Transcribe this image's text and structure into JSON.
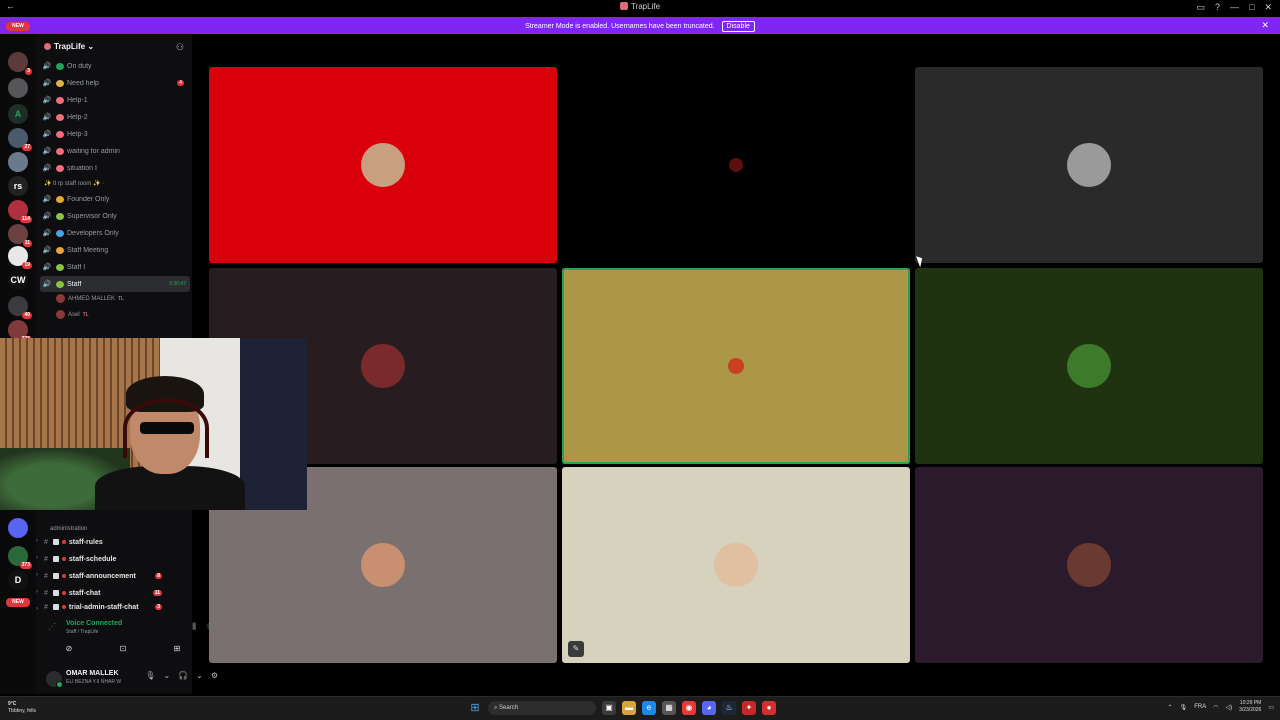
{
  "window": {
    "title": "TrapLife"
  },
  "banner": {
    "text": "Streamer Mode is enabled. Usernames have been truncated.",
    "disable_label": "Disable",
    "close_icon": "✕",
    "color": "#7f26f0"
  },
  "rail": {
    "new_top": "NEW",
    "new_bottom": "NEW",
    "servers": [
      {
        "label": "",
        "badge": "3"
      },
      {
        "label": "",
        "badge": ""
      },
      {
        "label": "A",
        "badge": ""
      },
      {
        "label": "",
        "badge": "27"
      },
      {
        "label": "",
        "badge": ""
      },
      {
        "label": "rs",
        "badge": ""
      },
      {
        "label": "",
        "badge": "114"
      },
      {
        "label": "",
        "badge": "11"
      },
      {
        "label": "",
        "badge": "19"
      },
      {
        "label": "CW",
        "badge": ""
      },
      {
        "label": "",
        "badge": "40"
      },
      {
        "label": "",
        "badge": "376"
      },
      {
        "label": "",
        "badge": ""
      },
      {
        "label": "",
        "badge": ""
      },
      {
        "label": "",
        "badge": "373"
      },
      {
        "label": "D",
        "badge": ""
      }
    ]
  },
  "server": {
    "name": "TrapLife",
    "chevron": "⌄"
  },
  "voice_channels": [
    {
      "label": "On duty",
      "color": "#23a559",
      "count": ""
    },
    {
      "label": "Need help",
      "color": "#dbb14a",
      "count": "4"
    },
    {
      "label": "Help-1",
      "color": "#f26d7d",
      "count": ""
    },
    {
      "label": "Help-2",
      "color": "#f26d7d",
      "count": ""
    },
    {
      "label": "Help-3",
      "color": "#f26d7d",
      "count": ""
    },
    {
      "label": "waiting for admin",
      "color": "#f26d7d",
      "count": ""
    },
    {
      "label": "situation I",
      "color": "#f26d7d",
      "count": ""
    }
  ],
  "staff_category": "✨ tl rp staff room ✨ ·",
  "staff_channels": [
    {
      "label": "Founder Only",
      "color": "#e8a53a"
    },
    {
      "label": "Supervisor Only",
      "color": "#8bc34a"
    },
    {
      "label": "Developers Only",
      "color": "#4aa3df"
    },
    {
      "label": "Staff Meeting",
      "color": "#e8a53a"
    },
    {
      "label": "Staff I",
      "color": "#8bc34a"
    }
  ],
  "active_channel": {
    "label": "Staff",
    "timer": "9:30:47"
  },
  "voice_users": [
    {
      "name": "AHMED MALLEK",
      "tag": "TL"
    },
    {
      "name": "Asel",
      "tag": "TL"
    }
  ],
  "admin_category": "administration",
  "text_channels": [
    {
      "label": "staff-rules",
      "count": ""
    },
    {
      "label": "staff-schedule",
      "count": ""
    },
    {
      "label": "staff-announcement",
      "count": "8"
    },
    {
      "label": "staff-chat",
      "count": "11"
    },
    {
      "label": "trial-admin-staff-chat",
      "count": "3"
    }
  ],
  "voice_panel": {
    "status": "Voice Connected",
    "location": "Staff / TrapLife"
  },
  "user": {
    "name": "OMAR MALLEK",
    "status": "ELI BEZNA Y.II NHAR W"
  },
  "tiles": [
    {
      "name": "tile-1",
      "bg": "#d9000b",
      "avatar_bg": "#c8a080",
      "speaking": false,
      "muted": false
    },
    {
      "name": "tile-2",
      "bg": "#000000",
      "avatar_bg": "#5a1010",
      "speaking": false,
      "muted": false
    },
    {
      "name": "tile-3",
      "bg": "#2a2a2a",
      "avatar_bg": "#9a9a9a",
      "speaking": false,
      "muted": false
    },
    {
      "name": "tile-4",
      "bg": "#271d21",
      "avatar_bg": "#7a2a2a",
      "speaking": false,
      "muted": false
    },
    {
      "name": "tile-5",
      "bg": "#ac9648",
      "avatar_bg": "#c84020",
      "speaking": true,
      "muted": false
    },
    {
      "name": "tile-6",
      "bg": "#1f3310",
      "avatar_bg": "#3e7a2c",
      "speaking": false,
      "muted": false
    },
    {
      "name": "tile-7",
      "bg": "#7a7070",
      "avatar_bg": "#c89070",
      "speaking": false,
      "muted": false
    },
    {
      "name": "tile-8",
      "bg": "#d6d2bd",
      "avatar_bg": "#e0c0a0",
      "speaking": false,
      "muted": true
    },
    {
      "name": "tile-9",
      "bg": "#2b1a2b",
      "avatar_bg": "#6a3a30",
      "speaking": false,
      "muted": false
    }
  ],
  "taskbar": {
    "weather_temp": "9°C",
    "weather_desc": "Tbbbny, fells",
    "search_label": "Search",
    "lang": "FRA",
    "time": "10:29 PM",
    "date": "3/23/2026"
  }
}
